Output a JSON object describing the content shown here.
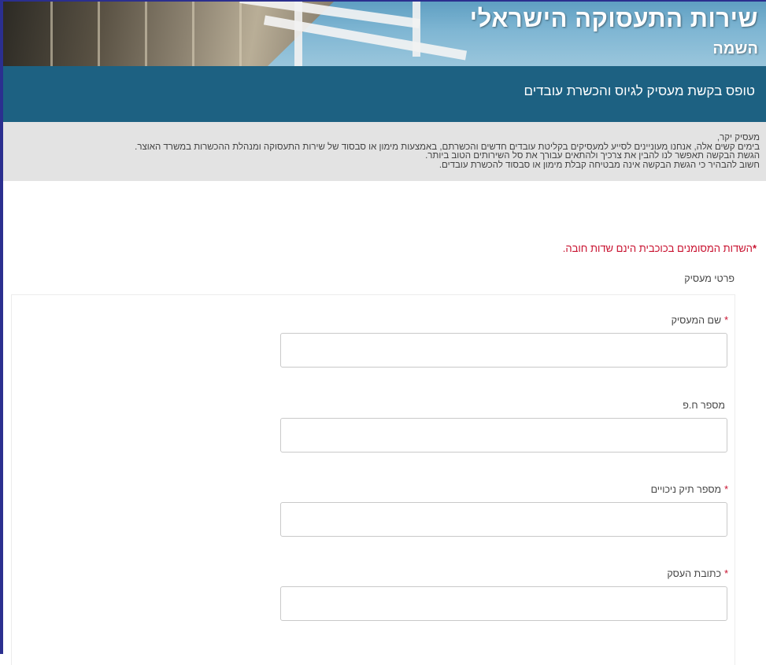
{
  "banner": {
    "title": "שירות התעסוקה הישראלי",
    "subtitle": "השמה"
  },
  "form": {
    "title": "טופס בקשת מעסיק לגיוס והכשרת עובדים"
  },
  "intro": {
    "lines": [
      "מעסיק יקר,",
      "בימים קשים אלה, אנחנו מעוניינים לסייע למעסיקים בקליטת עובדים חדשים והכשרתם, באמצעות מימון או סבסוד של שירות התעסוקה ומנהלת ההכשרות במשרד האוצר.",
      "הגשת הבקשה תאפשר לנו להבין את צרכיך ולהתאים עבורך את סל השירותים הטוב ביותר.",
      "חשוב להבהיר כי הגשת הבקשה אינה מבטיחה קבלת מימון או סבסוד להכשרת עובדים."
    ]
  },
  "required_note": {
    "star": "*",
    "text": "השדות המסומנים בכוכבית הינם שדות חובה."
  },
  "section": {
    "label": "פרטי מעסיק"
  },
  "fields": [
    {
      "label": "שם המעסיק",
      "required": "*",
      "value": ""
    },
    {
      "label": "מספר ח.פ",
      "required": "",
      "value": ""
    },
    {
      "label": "מספר תיק ניכויים",
      "required": "*",
      "value": ""
    },
    {
      "label": "כתובת העסק",
      "required": "*",
      "value": ""
    }
  ],
  "colors": {
    "title_bar": "#1d6182",
    "intro_bg": "#e3e3e3",
    "required": "#c8102e",
    "frame": "#2b2f8f"
  }
}
